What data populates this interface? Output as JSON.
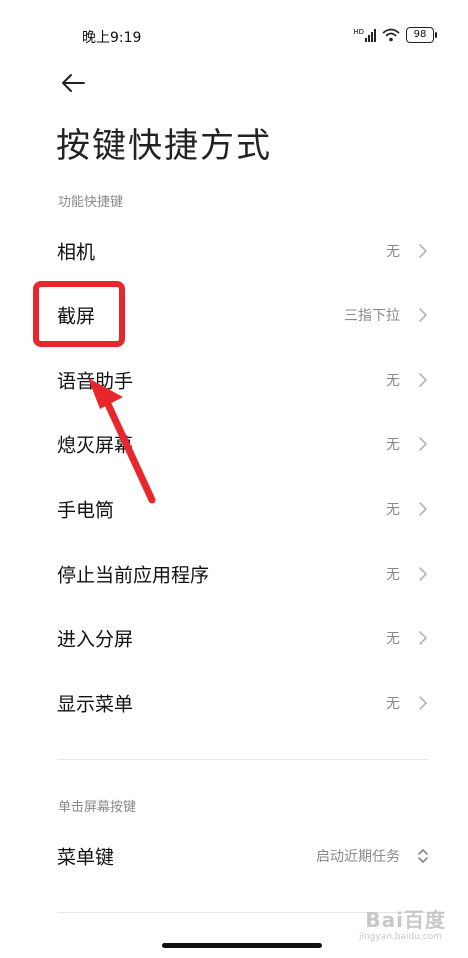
{
  "status_bar": {
    "time": "晚上9:19",
    "network": "HD",
    "battery": "98"
  },
  "header": {
    "title": "按键快捷方式"
  },
  "sections": [
    {
      "header": "功能快捷键",
      "items": [
        {
          "label": "相机",
          "value": "无"
        },
        {
          "label": "截屏",
          "value": "三指下拉"
        },
        {
          "label": "语音助手",
          "value": "无"
        },
        {
          "label": "熄灭屏幕",
          "value": "无"
        },
        {
          "label": "手电筒",
          "value": "无"
        },
        {
          "label": "停止当前应用程序",
          "value": "无"
        },
        {
          "label": "进入分屏",
          "value": "无"
        },
        {
          "label": "显示菜单",
          "value": "无"
        }
      ]
    },
    {
      "header": "单击屏幕按键",
      "items": [
        {
          "label": "菜单键",
          "value": "启动近期任务"
        }
      ]
    }
  ],
  "watermark": {
    "text": "Bai百度",
    "sub": "jingyan.baidu.com"
  },
  "colors": {
    "annotation": "#e8272d",
    "secondary_text": "#8a8a8a"
  }
}
